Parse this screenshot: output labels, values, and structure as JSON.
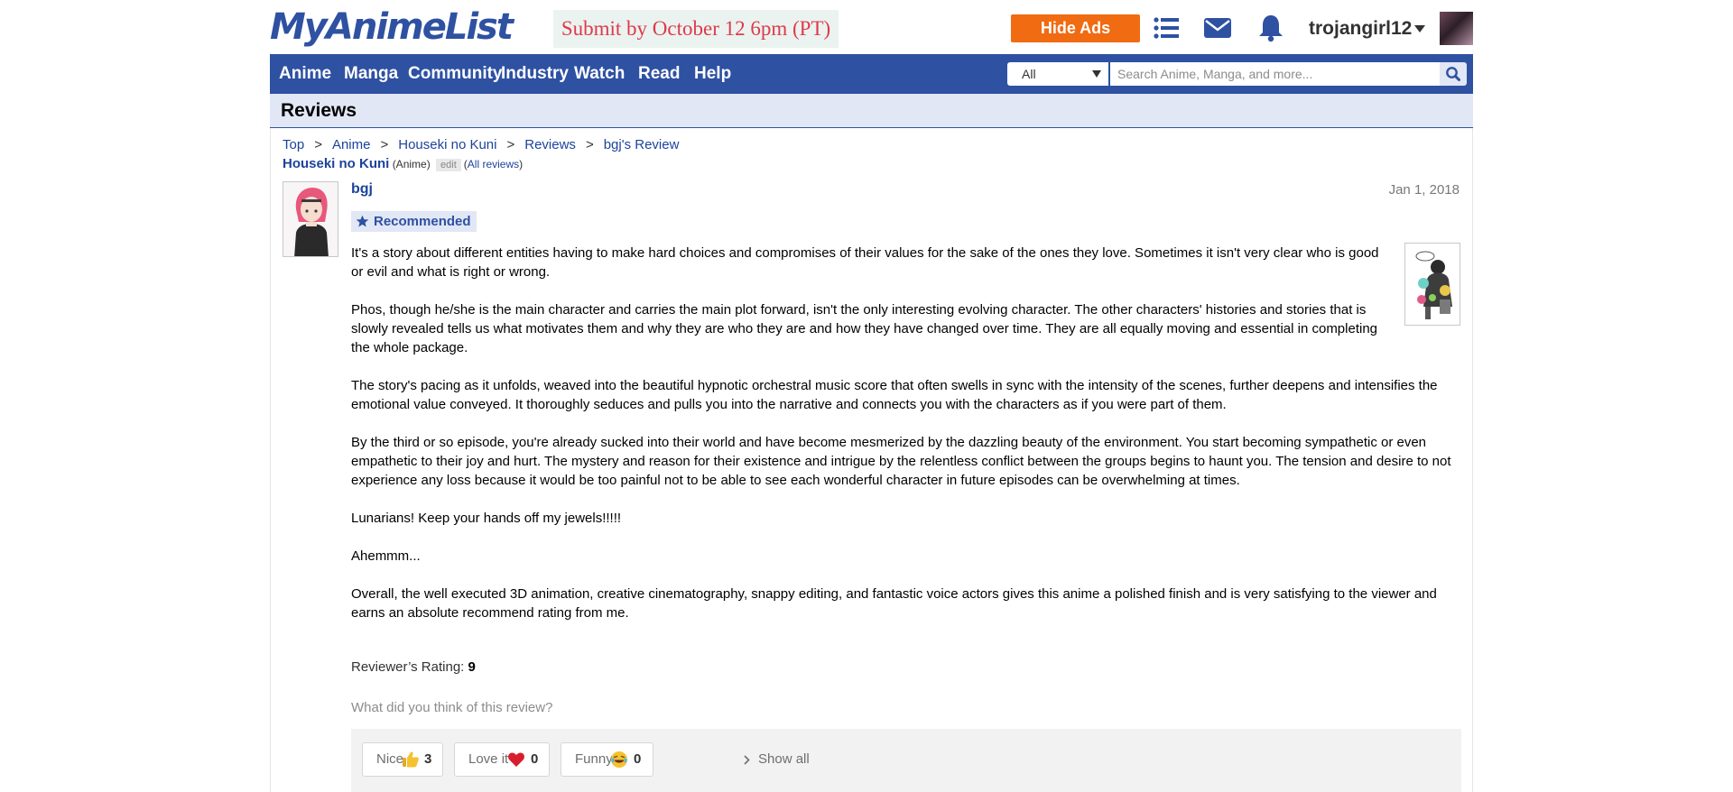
{
  "header": {
    "logo": "MyAnimeList",
    "promo": "Submit by October 12 6pm (PT)",
    "hide_ads": "Hide Ads",
    "username": "trojangirl12",
    "icons": [
      "list-icon",
      "mail-icon",
      "bell-icon"
    ]
  },
  "nav": {
    "items": [
      "Anime",
      "Manga",
      "Community",
      "Industry",
      "Watch",
      "Read",
      "Help"
    ],
    "search_filter": "All",
    "search_placeholder": "Search Anime, Manga, and more..."
  },
  "page": {
    "title": "Reviews"
  },
  "breadcrumb": [
    "Top",
    "Anime",
    "Houseki no Kuni",
    "Reviews",
    "bgj's Review"
  ],
  "anime": {
    "title": "Houseki no Kuni",
    "type": "(Anime)",
    "edit": "edit",
    "all_reviews": "All reviews"
  },
  "review": {
    "reviewer": "bgj",
    "date": "Jan 1, 2018",
    "tag": "Recommended",
    "paragraphs": [
      "It's a story about different entities having to make hard choices and compromises of their values for the sake of the ones they love. Sometimes it isn't very clear who is good or evil and what is right or wrong.",
      "Phos, though he/she is the main character and carries the main plot forward, isn't the only interesting evolving character. The other characters' histories and stories that is slowly revealed tells us what motivates them and why they are who they are and how they have changed over time. They are all equally moving and essential in completing the whole package.",
      "The story's pacing as it unfolds, weaved into the beautiful hypnotic orchestral music score that often swells in sync with the intensity of the scenes, further deepens and intensifies the emotional value conveyed. It thoroughly seduces and pulls you into the narrative and connects you with the characters as if you were part of them.",
      "By the third or so episode, you're already sucked into their world and have become mesmerized by the dazzling beauty of the environment. You start becoming sympathetic or even empathetic to their joy and hurt. The mystery and reason for their existence and intrigue by the relentless conflict between the groups begins to haunt you. The tension and desire to not experience any loss because it would be too painful not to be able to see each wonderful character in future episodes can be overwhelming at times.",
      "Lunarians! Keep your hands off my jewels!!!!!",
      "Ahemmm...",
      "Overall, the well executed 3D animation, creative cinematography, snappy editing, and fantastic voice actors gives this anime a polished finish and is very satisfying to the viewer and earns an absolute recommend rating from me."
    ],
    "rating_label": "Reviewer’s Rating:",
    "rating_value": "9"
  },
  "feedback": {
    "prompt": "What did you think of this review?",
    "reactions": [
      {
        "label": "Nice",
        "icon": "thumbs-up-icon",
        "count": "3"
      },
      {
        "label": "Love it",
        "icon": "heart-icon",
        "count": "0"
      },
      {
        "label": "Funny",
        "icon": "laughing-face-icon",
        "count": "0"
      }
    ],
    "show_all": "Show all"
  },
  "colors": {
    "brand_blue": "#2e51a2",
    "link_blue": "#1c439b",
    "accent_orange": "#f06b12",
    "promo_red": "#e0394a",
    "title_bar": "#e1e7f5"
  }
}
